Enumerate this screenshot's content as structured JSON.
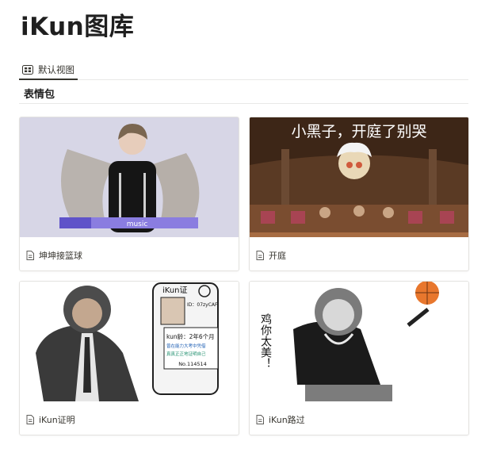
{
  "page": {
    "title": "iKun图库"
  },
  "views": {
    "active": {
      "label": "默认视图",
      "icon": "gallery-grid-icon"
    }
  },
  "group": {
    "name": "表情包"
  },
  "cards": [
    {
      "title": "坤坤接篮球",
      "icon": "page-icon",
      "overlay": {
        "badge": "music"
      }
    },
    {
      "title": "开庭",
      "icon": "page-icon",
      "overlay": {
        "caption": "小黑子，开庭了别哭"
      }
    },
    {
      "title": "iKun证明",
      "icon": "page-icon",
      "overlay": {
        "card_title": "iKun证",
        "id_line": "ID：07zyCAF",
        "line1": "kun龄：2年6个月",
        "line2": "曾在能力大考中凭借",
        "line3": "真真正正地证明自己",
        "number": "No.114514"
      }
    },
    {
      "title": "iKun路过",
      "icon": "page-icon",
      "overlay": {
        "vertical_text": "鸡你太美！"
      }
    }
  ]
}
